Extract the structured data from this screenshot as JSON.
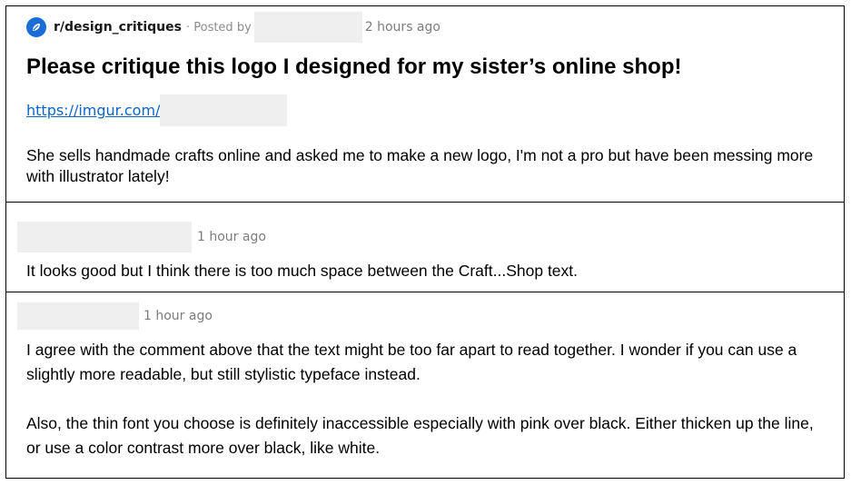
{
  "post": {
    "subreddit": "r/design_critiques",
    "posted_by": "· Posted by",
    "time": "2 hours ago",
    "title": "Please critique this logo I designed for my sister’s online shop!",
    "link": "https://imgur.com/",
    "body": "She sells handmade crafts online and asked me to make a new logo, I'm not a pro but have been messing more with illustrator lately!"
  },
  "comments": [
    {
      "time": "1 hour ago",
      "body": "It looks good but I think there is too much space between the Craft...Shop text."
    },
    {
      "time": "1 hour ago",
      "paragraphs": [
        "I agree with the comment above that the text might be too far apart to read together. I wonder if you can use a slightly more readable, but still stylistic typeface instead.",
        "Also, the thin font you choose is definitely inaccessible especially with pink over black. Either thicken up the line, or use a color contrast more over black, like white."
      ]
    }
  ],
  "icons": {
    "subreddit": "subreddit-icon"
  },
  "colors": {
    "subreddit_icon": "#1a6dd6",
    "link": "#0b66c9",
    "redaction": "#efefef"
  }
}
